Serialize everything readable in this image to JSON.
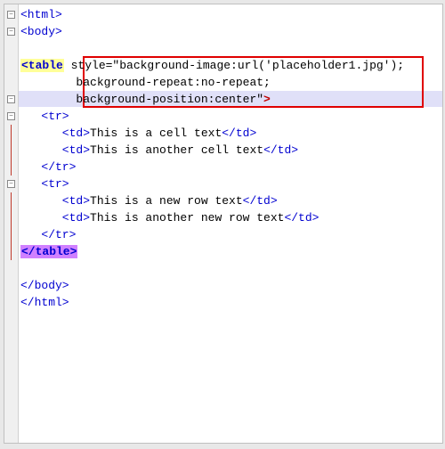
{
  "fold": {
    "minus": "−",
    "line": ""
  },
  "code": {
    "l1_a": "<html>",
    "l2_a": "<body>",
    "l3": "",
    "l4_tag": "<table",
    "l4_attr": " style=\"background-image:url('placeholder1.jpg');",
    "l5_attr": "        background-repeat:no-repeat;",
    "l6_attr": "        background-position:center\"",
    "l6_end": ">",
    "l7_a": "   <tr>",
    "l8_a": "      <td>",
    "l8_b": "This is a cell text",
    "l8_c": "</td>",
    "l9_a": "      <td>",
    "l9_b": "This is another cell text",
    "l9_c": "</td>",
    "l10_a": "   </tr>",
    "l11_a": "   <tr>",
    "l12_a": "      <td>",
    "l12_b": "This is a new row text",
    "l12_c": "</td>",
    "l13_a": "      <td>",
    "l13_b": "This is another new row text",
    "l13_c": "</td>",
    "l14_a": "   </tr>",
    "l15_a": "</table>",
    "l16": "",
    "l17_a": "</body>",
    "l18_a": "</html>"
  }
}
